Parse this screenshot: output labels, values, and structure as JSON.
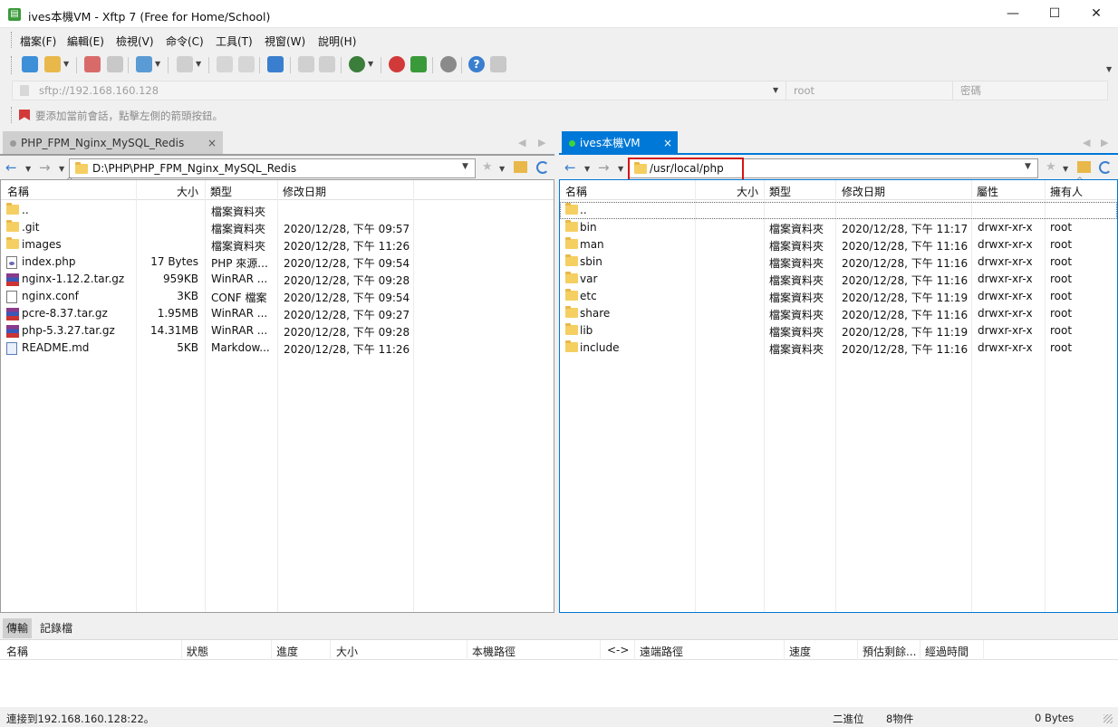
{
  "window": {
    "title": "ives本機VM - Xftp 7 (Free for Home/School)",
    "minimize": "—",
    "maximize": "☐",
    "close": "✕"
  },
  "menu": [
    "檔案(F)",
    "編輯(E)",
    "檢視(V)",
    "命令(C)",
    "工具(T)",
    "視窗(W)",
    "說明(H)"
  ],
  "address": {
    "host_placeholder": "sftp://192.168.160.128",
    "user_placeholder": "root",
    "password_placeholder": "密碼"
  },
  "hint": "要添加當前會話，點擊左側的箭頭按鈕。",
  "left": {
    "tab": "PHP_FPM_Nginx_MySQL_Redis",
    "path": "D:\\PHP\\PHP_FPM_Nginx_MySQL_Redis",
    "columns": [
      "名稱",
      "大小",
      "類型",
      "修改日期"
    ],
    "rows": [
      {
        "name": "..",
        "size": "",
        "type": "檔案資料夾",
        "date": "",
        "icon": "folder"
      },
      {
        "name": ".git",
        "size": "",
        "type": "檔案資料夾",
        "date": "2020/12/28, 下午 09:57",
        "icon": "folder"
      },
      {
        "name": "images",
        "size": "",
        "type": "檔案資料夾",
        "date": "2020/12/28, 下午 11:26",
        "icon": "folder"
      },
      {
        "name": "index.php",
        "size": "17 Bytes",
        "type": "PHP 來源...",
        "date": "2020/12/28, 下午 09:54",
        "icon": "php"
      },
      {
        "name": "nginx-1.12.2.tar.gz",
        "size": "959KB",
        "type": "WinRAR ...",
        "date": "2020/12/28, 下午 09:28",
        "icon": "rar"
      },
      {
        "name": "nginx.conf",
        "size": "3KB",
        "type": "CONF 檔案",
        "date": "2020/12/28, 下午 09:54",
        "icon": "file"
      },
      {
        "name": "pcre-8.37.tar.gz",
        "size": "1.95MB",
        "type": "WinRAR ...",
        "date": "2020/12/28, 下午 09:27",
        "icon": "rar"
      },
      {
        "name": "php-5.3.27.tar.gz",
        "size": "14.31MB",
        "type": "WinRAR ...",
        "date": "2020/12/28, 下午 09:28",
        "icon": "rar"
      },
      {
        "name": "README.md",
        "size": "5KB",
        "type": "Markdow...",
        "date": "2020/12/28, 下午 11:26",
        "icon": "md"
      }
    ]
  },
  "right": {
    "tab": "ives本機VM",
    "tab_close": "×",
    "path": "/usr/local/php",
    "columns": [
      "名稱",
      "大小",
      "類型",
      "修改日期",
      "屬性",
      "擁有人"
    ],
    "rows": [
      {
        "name": "..",
        "type": "",
        "date": "",
        "attr": "",
        "owner": ""
      },
      {
        "name": "bin",
        "type": "檔案資料夾",
        "date": "2020/12/28, 下午 11:17",
        "attr": "drwxr-xr-x",
        "owner": "root"
      },
      {
        "name": "man",
        "type": "檔案資料夾",
        "date": "2020/12/28, 下午 11:16",
        "attr": "drwxr-xr-x",
        "owner": "root"
      },
      {
        "name": "sbin",
        "type": "檔案資料夾",
        "date": "2020/12/28, 下午 11:16",
        "attr": "drwxr-xr-x",
        "owner": "root"
      },
      {
        "name": "var",
        "type": "檔案資料夾",
        "date": "2020/12/28, 下午 11:16",
        "attr": "drwxr-xr-x",
        "owner": "root"
      },
      {
        "name": "etc",
        "type": "檔案資料夾",
        "date": "2020/12/28, 下午 11:19",
        "attr": "drwxr-xr-x",
        "owner": "root"
      },
      {
        "name": "share",
        "type": "檔案資料夾",
        "date": "2020/12/28, 下午 11:16",
        "attr": "drwxr-xr-x",
        "owner": "root"
      },
      {
        "name": "lib",
        "type": "檔案資料夾",
        "date": "2020/12/28, 下午 11:19",
        "attr": "drwxr-xr-x",
        "owner": "root"
      },
      {
        "name": "include",
        "type": "檔案資料夾",
        "date": "2020/12/28, 下午 11:16",
        "attr": "drwxr-xr-x",
        "owner": "root"
      }
    ]
  },
  "bottom": {
    "tabs": [
      "傳輸",
      "記錄檔"
    ],
    "columns": [
      "名稱",
      "狀態",
      "進度",
      "大小",
      "本機路徑",
      "<->",
      "遠端路徑",
      "速度",
      "預估剩餘...",
      "經過時間"
    ]
  },
  "status": {
    "connection": "連接到192.168.160.128:22。",
    "mode": "二進位",
    "count": "8物件",
    "size": "0 Bytes"
  },
  "colors": {
    "accent": "#0078d7",
    "highlight": "#d41414"
  }
}
